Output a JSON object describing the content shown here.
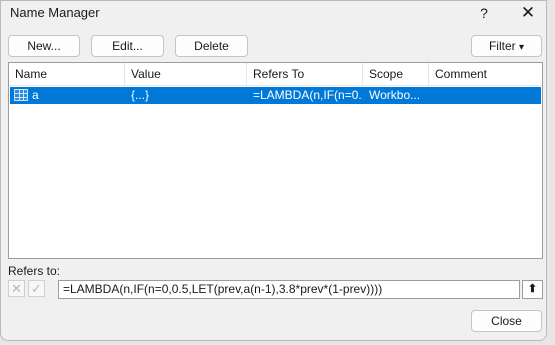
{
  "window": {
    "title": "Name Manager",
    "help_glyph": "?",
    "close_glyph": "✕"
  },
  "toolbar": {
    "new_label": "New...",
    "edit_label": "Edit...",
    "delete_label": "Delete",
    "filter_label": "Filter",
    "filter_arrow": "▾"
  },
  "list": {
    "columns": [
      "Name",
      "Value",
      "Refers To",
      "Scope",
      "Comment"
    ],
    "rows": [
      {
        "name": "a",
        "value": "{...}",
        "refers_to": "=LAMBDA(n,IF(n=0...",
        "scope": "Workbo...",
        "comment": ""
      }
    ],
    "selected_color": "#0078d7"
  },
  "refers": {
    "label": "Refers to:",
    "cancel_glyph": "✕",
    "confirm_glyph": "✓",
    "formula": "=LAMBDA(n,IF(n=0,0.5,LET(prev,a(n-1),3.8*prev*(1-prev))))",
    "collapse_glyph": "⬆"
  },
  "footer": {
    "close_label": "Close"
  }
}
